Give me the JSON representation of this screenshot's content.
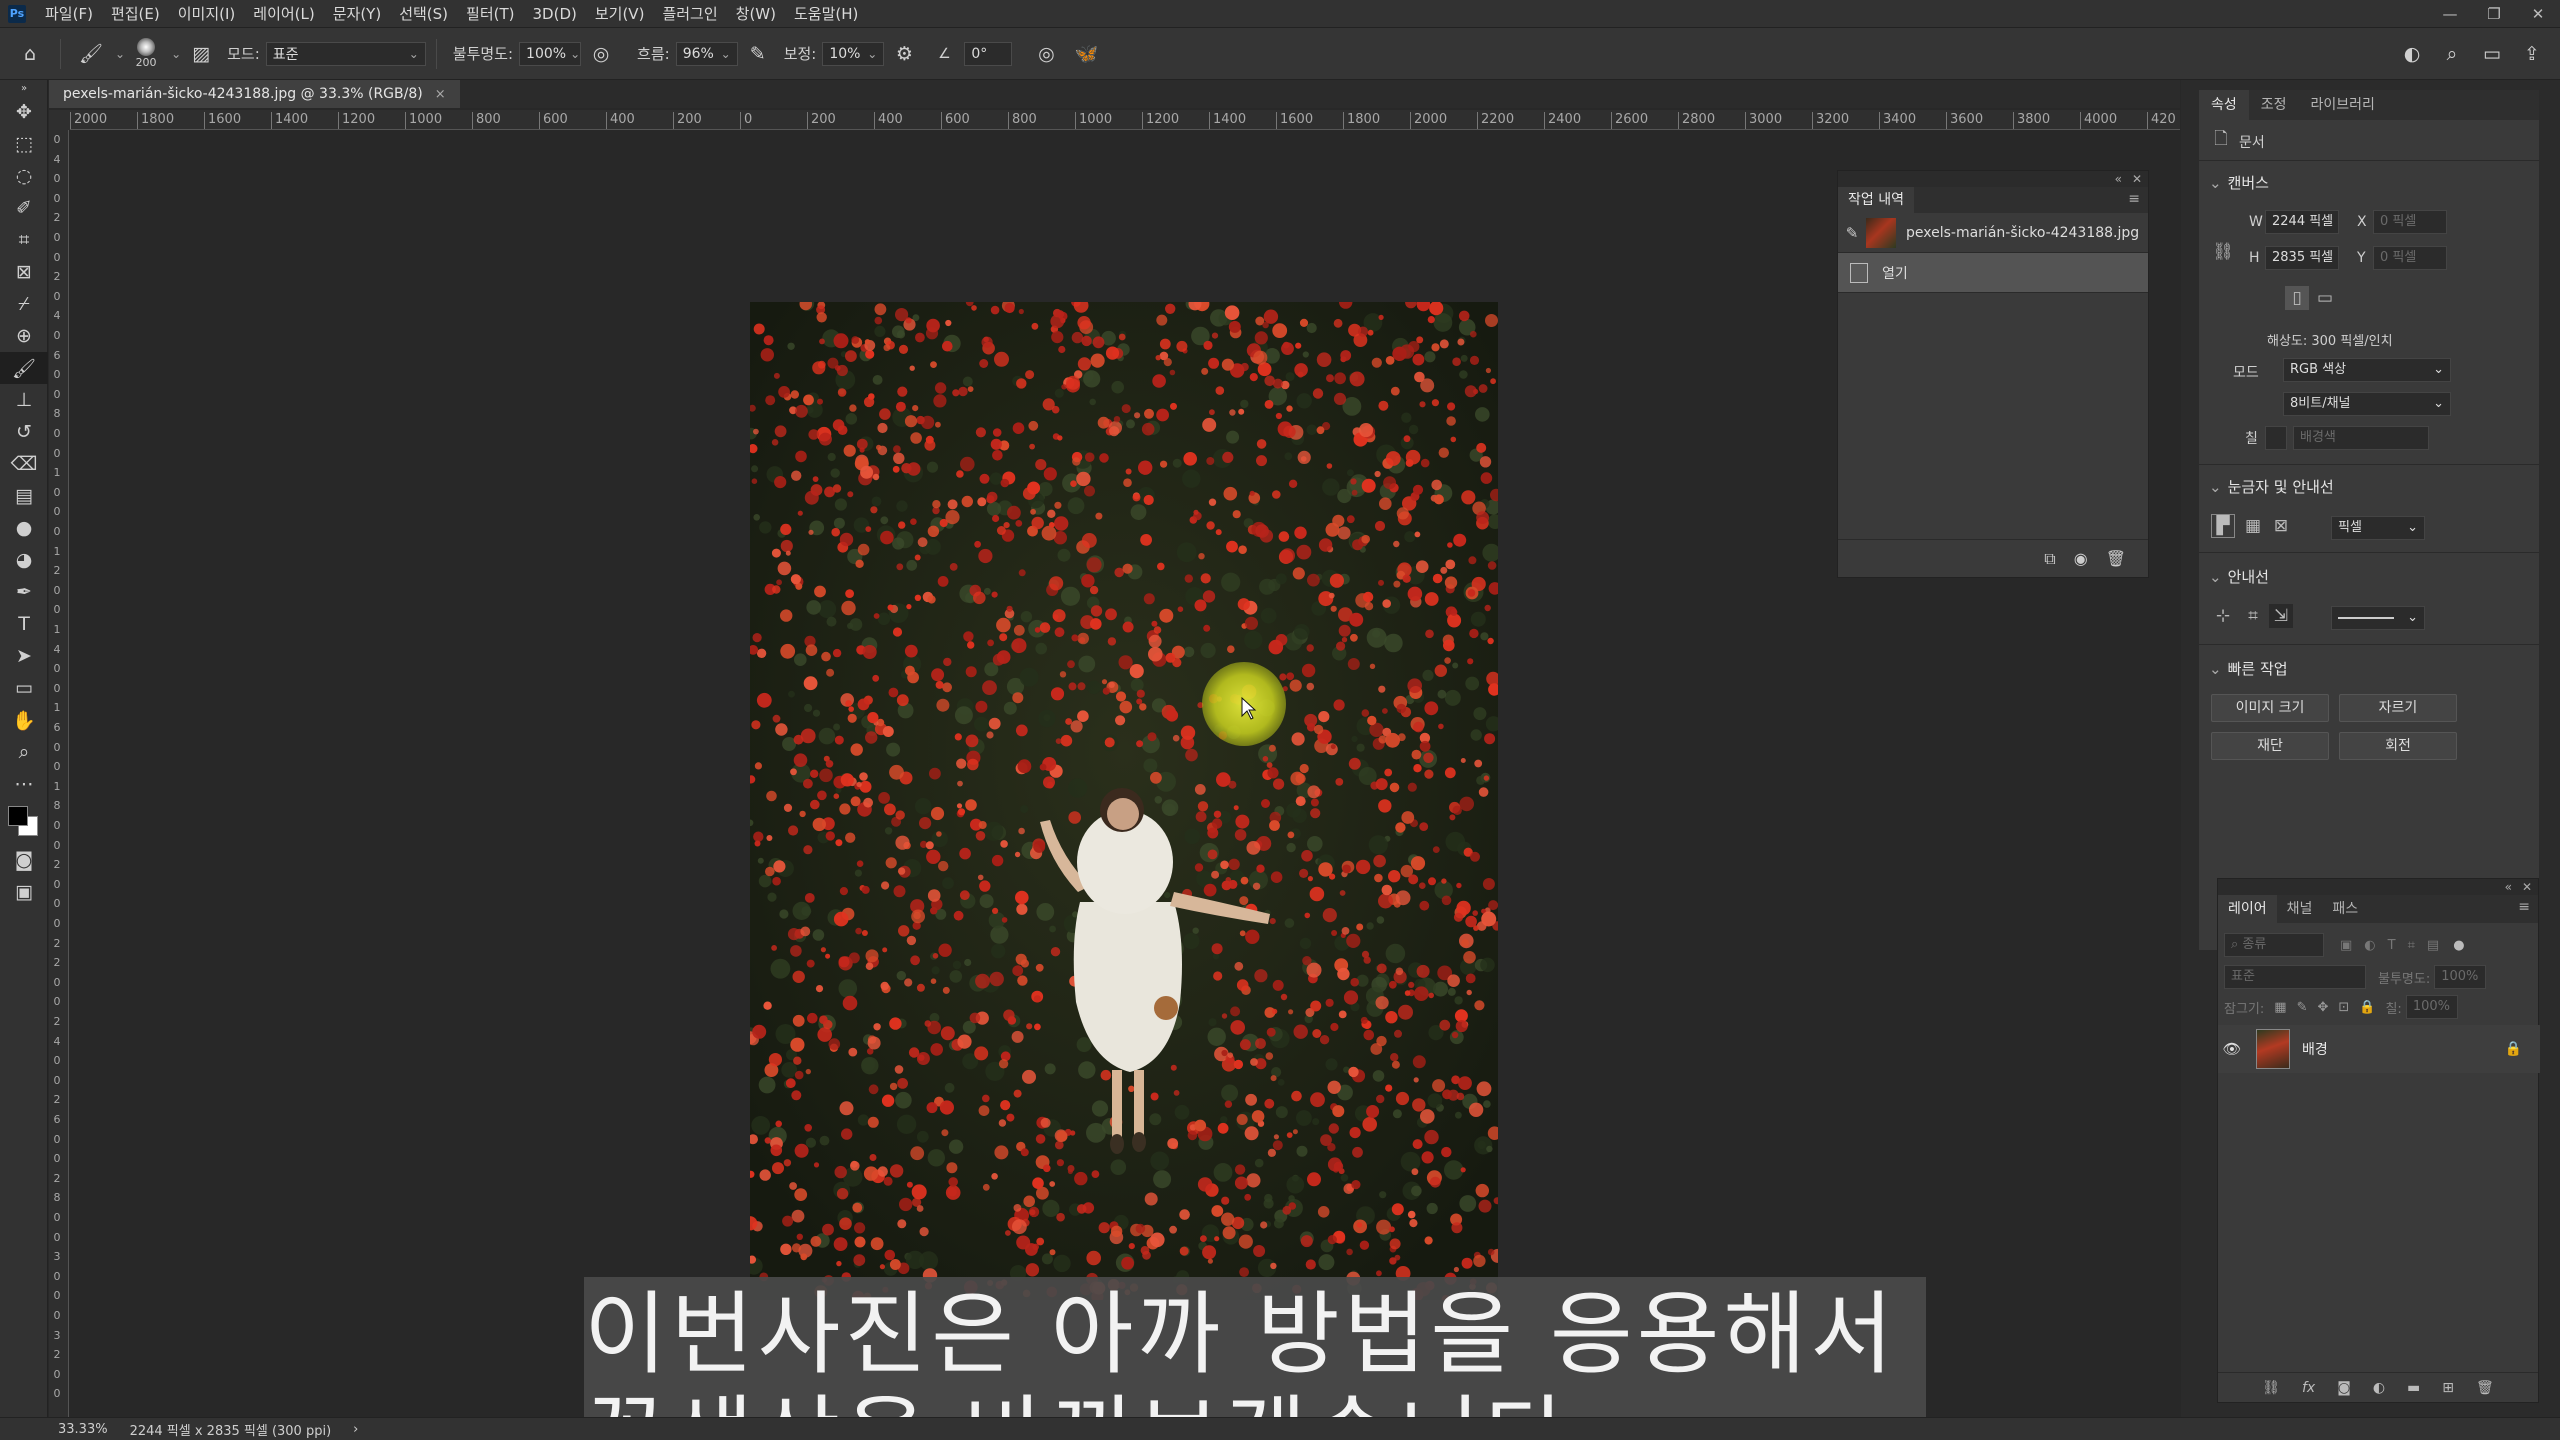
{
  "menubar": {
    "logo": "Ps",
    "items": [
      "파일(F)",
      "편집(E)",
      "이미지(I)",
      "레이어(L)",
      "문자(Y)",
      "선택(S)",
      "필터(T)",
      "3D(D)",
      "보기(V)",
      "플러그인",
      "창(W)",
      "도움말(H)"
    ],
    "window_controls": [
      "—",
      "❐",
      "✕"
    ]
  },
  "options": {
    "brush_size": "200",
    "mode_label": "모드:",
    "mode_value": "표준",
    "opacity_label": "불투명도:",
    "opacity_value": "100%",
    "flow_label": "흐름:",
    "flow_value": "96%",
    "smoothing_label": "보정:",
    "smoothing_value": "10%",
    "angle_value": "0°"
  },
  "document": {
    "tab_title": "pexels-marián-šicko-4243188.jpg @ 33.3% (RGB/8)",
    "tab_close": "×"
  },
  "ruler_top": [
    "2000",
    "1800",
    "1600",
    "1400",
    "1200",
    "1000",
    "800",
    "600",
    "400",
    "200",
    "0",
    "200",
    "400",
    "600",
    "800",
    "1000",
    "1200",
    "1400",
    "1600",
    "1800",
    "2000",
    "2200",
    "2400",
    "2600",
    "2800",
    "3000",
    "3200",
    "3400",
    "3600",
    "3800",
    "4000",
    "420"
  ],
  "ruler_left": [
    "0",
    "4",
    "0",
    "0",
    "2",
    "0",
    "0",
    "2",
    "0",
    "4",
    "0",
    "6",
    "0",
    "0",
    "8",
    "0",
    "0",
    "1",
    "0",
    "0",
    "0",
    "1",
    "2",
    "0",
    "0",
    "1",
    "4",
    "0",
    "0",
    "1",
    "6",
    "0",
    "0",
    "1",
    "8",
    "0",
    "0",
    "2",
    "0",
    "0",
    "0",
    "2",
    "2",
    "0",
    "0",
    "2",
    "4",
    "0",
    "0",
    "2",
    "6",
    "0",
    "0",
    "2",
    "8",
    "0",
    "0",
    "3",
    "0",
    "0",
    "0",
    "3",
    "2",
    "0",
    "0"
  ],
  "subtitle": {
    "line1": "이번사진은 아까 방법을 응용해서",
    "line2": "꽃색상을 바꿔보겠습니다."
  },
  "status": {
    "zoom": "33.33%",
    "doc_info": "2244 픽셀 x 2835 픽셀 (300 ppi)",
    "arrow": "›"
  },
  "history": {
    "topbar_collapse": "«",
    "topbar_close": "✕",
    "tab": "작업 내역",
    "menu": "≡",
    "snapshot_name": "pexels-marián-šicko-4243188.jpg",
    "step_name": "열기"
  },
  "properties": {
    "tabs": [
      "속성",
      "조정",
      "라이브러리"
    ],
    "doc_label": "문서",
    "canvas_section": "캔버스",
    "w_label": "W",
    "w_value": "2244 픽셀",
    "h_label": "H",
    "h_value": "2835 픽셀",
    "x_label": "X",
    "x_placeholder": "0 픽셀",
    "y_label": "Y",
    "y_placeholder": "0 픽셀",
    "resolution": "해상도: 300 픽셀/인치",
    "mode_label": "모드",
    "mode_value": "RGB 색상",
    "depth_value": "8비트/채널",
    "fill_label": "칠",
    "fill_value": "배경색",
    "rulers_section": "눈금자 및 안내선",
    "units_value": "픽셀",
    "guides_section": "안내선",
    "quick_section": "빠른 작업",
    "btn_image_size": "이미지 크기",
    "btn_crop": "자르기",
    "btn_trim": "재단",
    "btn_rotate": "회전"
  },
  "layers": {
    "topbar_collapse": "«",
    "topbar_close": "✕",
    "tabs": [
      "레이어",
      "채널",
      "패스"
    ],
    "menu": "≡",
    "filter_placeholder": "종류",
    "blend_mode": "표준",
    "opacity_label": "불투명도:",
    "opacity_value": "100%",
    "lock_label": "잠그기:",
    "fill_label": "칠:",
    "fill_value": "100%",
    "layer_name": "배경"
  },
  "colors": {
    "accent_cursor": "#d4e020",
    "app_bg": "#282828",
    "panel_bg": "#3a3a3a"
  }
}
